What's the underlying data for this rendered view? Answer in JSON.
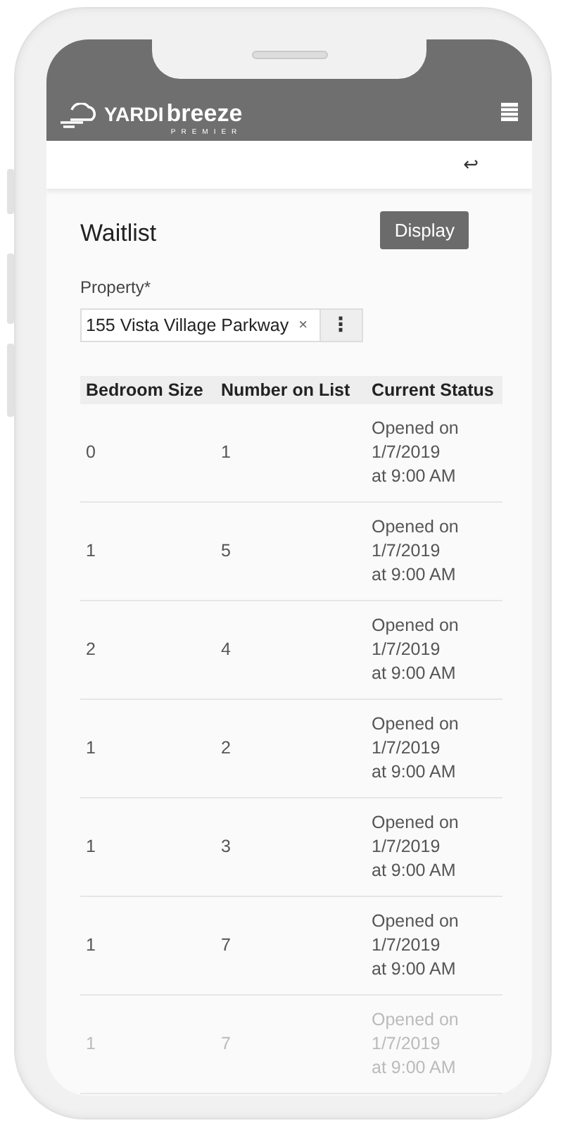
{
  "header": {
    "brand": "YARDI",
    "product": "breeze",
    "edition": "PREMIER"
  },
  "subbar": {
    "back_glyph": "↩"
  },
  "page": {
    "title": "Waitlist",
    "action": "Display"
  },
  "property_field": {
    "label": "Property*",
    "value": "155 Vista Village Parkway",
    "clear_glyph": "×",
    "menu_glyph": "⋮"
  },
  "table": {
    "columns": [
      "Bedroom Size",
      "Number on List",
      "Current Status"
    ],
    "rows": [
      {
        "cells": [
          "0",
          "1",
          [
            "Opened on",
            "1/7/2019",
            "at 9:00 AM"
          ]
        ]
      },
      {
        "cells": [
          "1",
          "5",
          [
            "Opened on",
            "1/7/2019",
            "at 9:00 AM"
          ]
        ]
      },
      {
        "cells": [
          "2",
          "4",
          [
            "Opened on",
            "1/7/2019",
            "at 9:00 AM"
          ]
        ]
      },
      {
        "cells": [
          "1",
          "2",
          [
            "Opened on",
            "1/7/2019",
            "at 9:00 AM"
          ]
        ]
      },
      {
        "cells": [
          "1",
          "3",
          [
            "Opened on",
            "1/7/2019",
            "at 9:00 AM"
          ]
        ]
      },
      {
        "cells": [
          "1",
          "7",
          [
            "Opened on",
            "1/7/2019",
            "at 9:00 AM"
          ]
        ]
      },
      {
        "cells": [
          "1",
          "7",
          [
            "Opened on",
            "1/7/2019",
            "at 9:00 AM"
          ]
        ]
      }
    ]
  }
}
